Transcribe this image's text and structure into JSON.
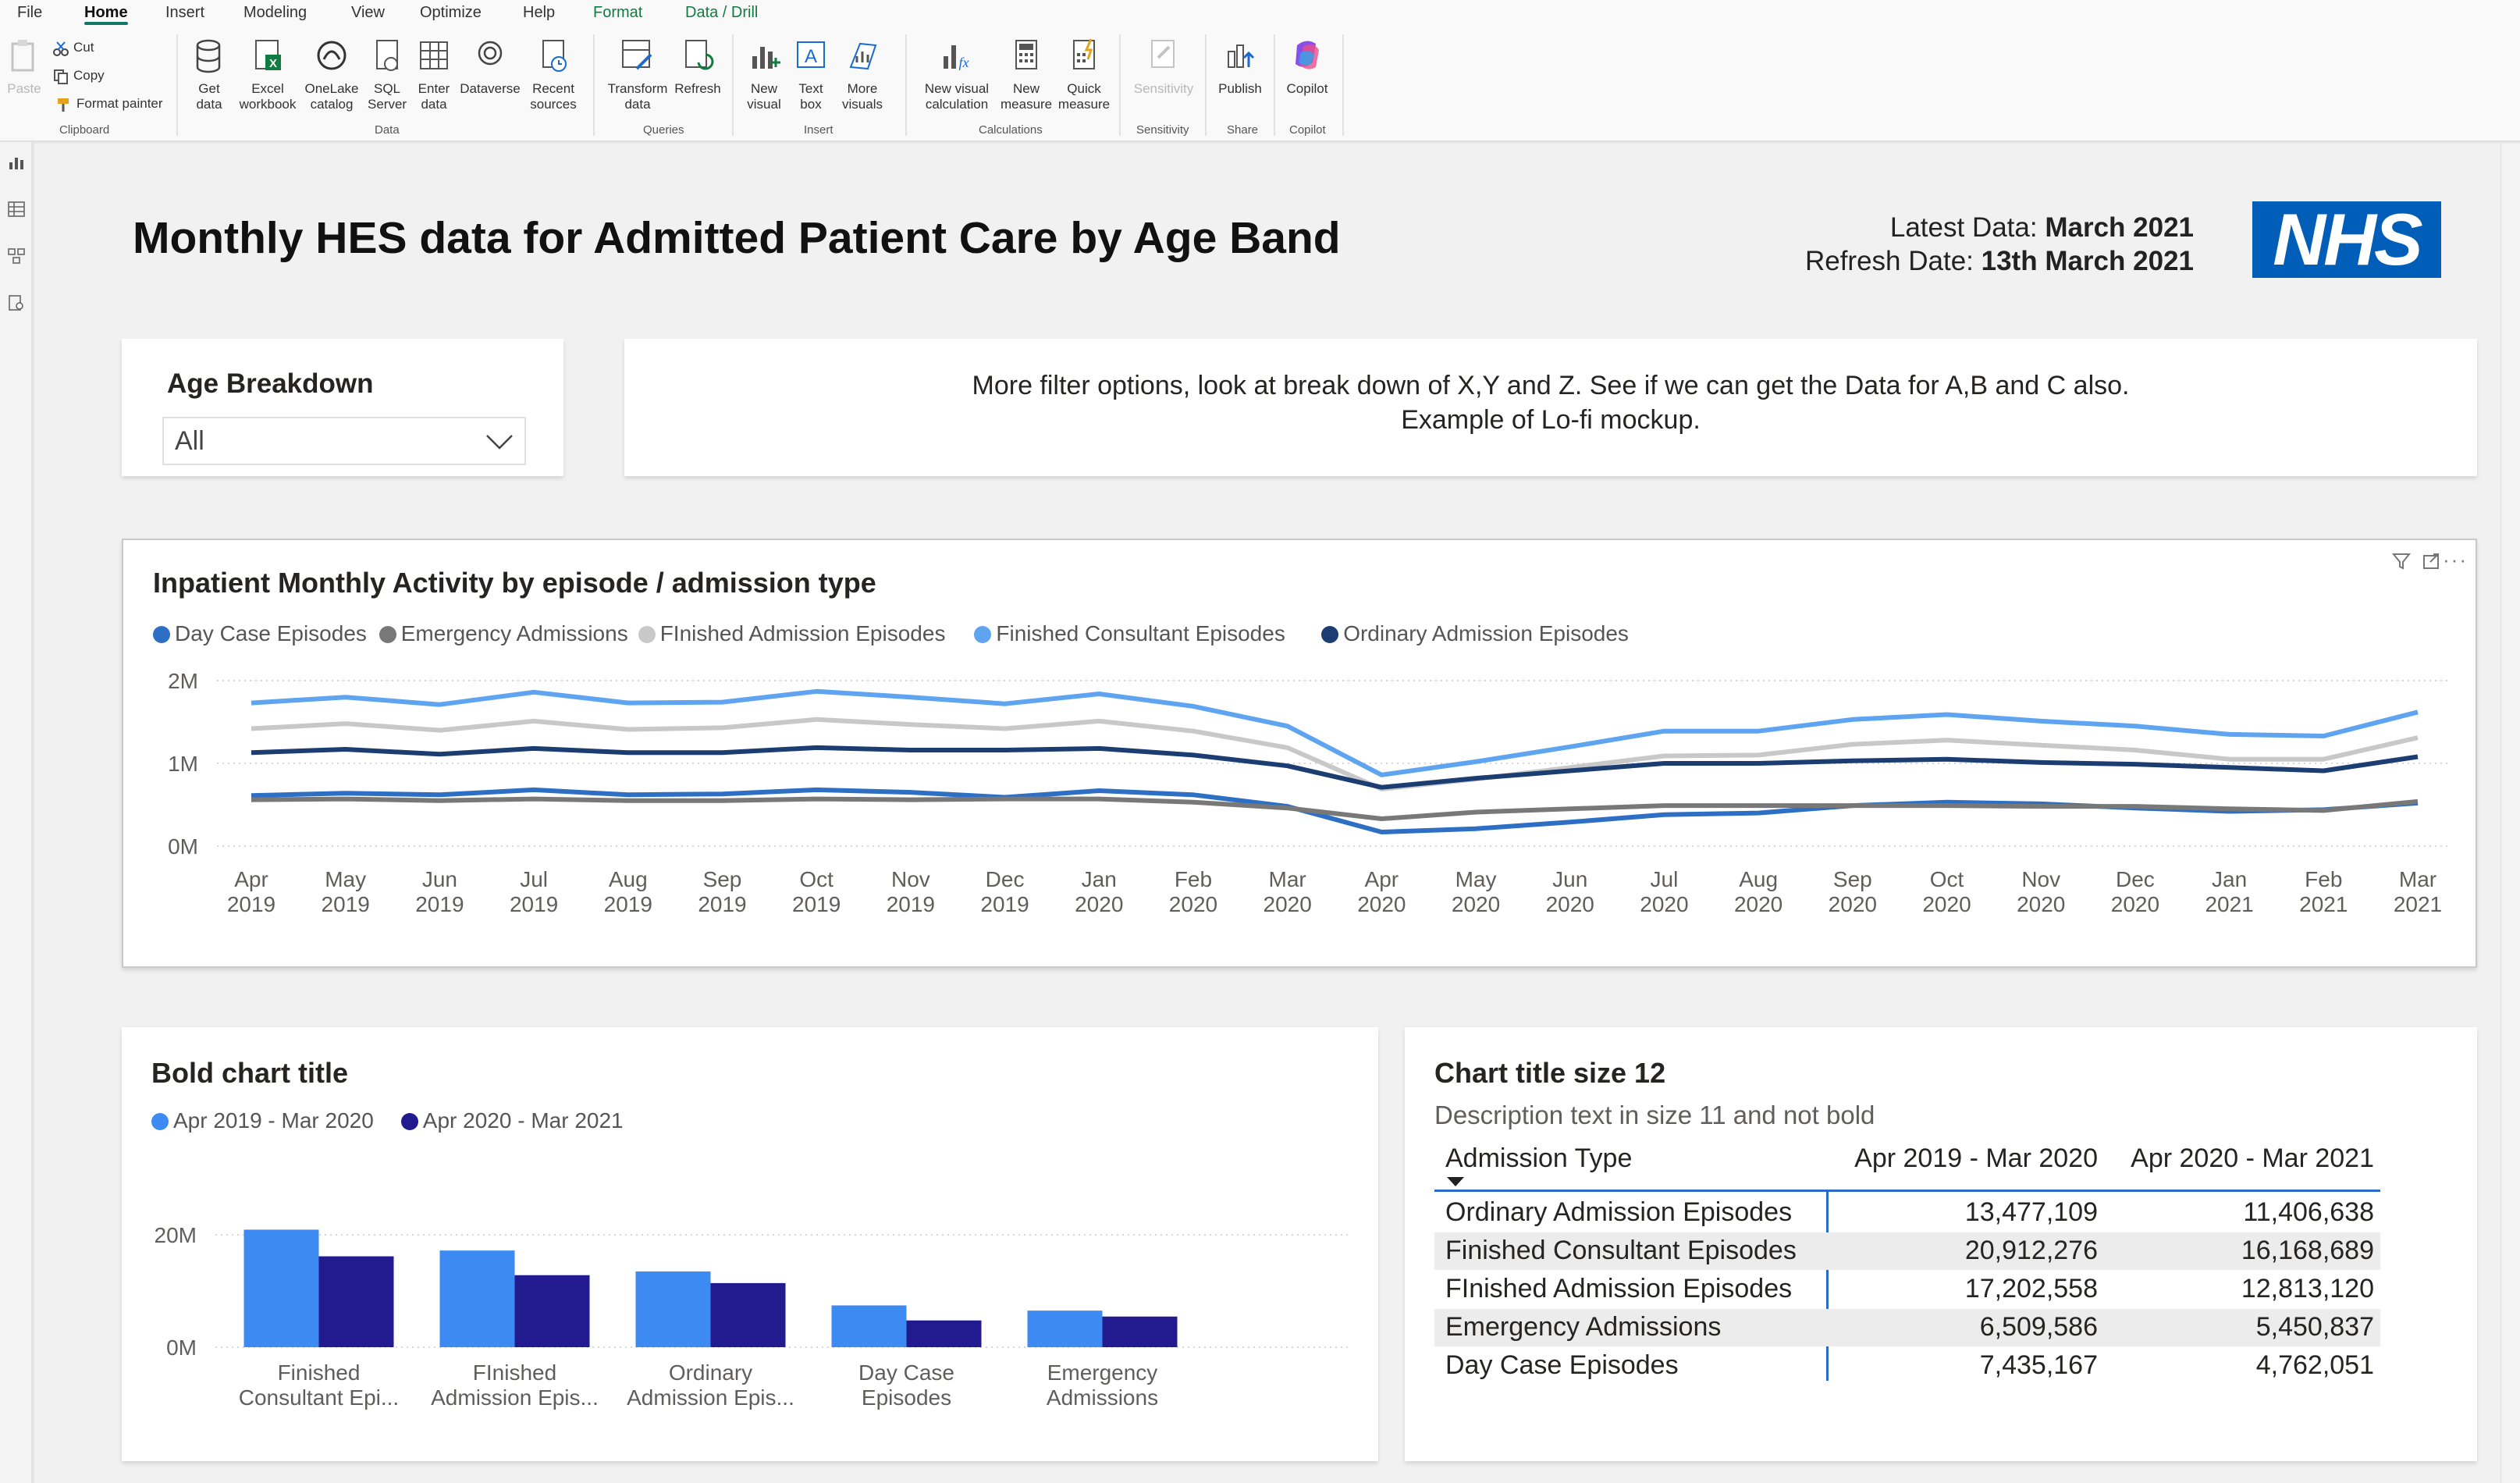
{
  "ribbon": {
    "tabs": [
      "File",
      "Home",
      "Insert",
      "Modeling",
      "View",
      "Optimize",
      "Help",
      "Format",
      "Data / Drill"
    ],
    "clipboard": {
      "paste": "Paste",
      "cut": "Cut",
      "copy": "Copy",
      "format_painter": "Format painter",
      "label": "Clipboard"
    },
    "data_group": {
      "get_data": "Get data",
      "excel": "Excel workbook",
      "onelake": "OneLake catalog",
      "sql": "SQL Server",
      "enter": "Enter data",
      "dataverse": "Dataverse",
      "recent": "Recent sources",
      "label": "Data"
    },
    "queries_group": {
      "transform": "Transform data",
      "refresh": "Refresh",
      "label": "Queries"
    },
    "insert_group": {
      "new_visual": "New visual",
      "text_box": "Text box",
      "more_visuals": "More visuals",
      "label": "Insert"
    },
    "calc_group": {
      "new_visual_calc": "New visual calculation",
      "new_measure": "New measure",
      "quick_measure": "Quick measure",
      "label": "Calculations"
    },
    "sensitivity_group": {
      "sensitivity": "Sensitivity",
      "label": "Sensitivity"
    },
    "share_group": {
      "publish": "Publish",
      "label": "Share"
    },
    "copilot_group": {
      "copilot": "Copilot",
      "label": "Copilot"
    }
  },
  "header": {
    "title": "Monthly HES data for Admitted Patient Care by Age Band",
    "latest_label": "Latest Data: ",
    "latest_value": "March 2021",
    "refresh_label": "Refresh Date: ",
    "refresh_value": "13th March 2021",
    "logo": "NHS"
  },
  "filter": {
    "title": "Age Breakdown",
    "selected": "All"
  },
  "notes": {
    "line1": "More filter options, look at break down of X,Y and Z. See if we can get the Data for A,B and C also.",
    "line2": "Example of Lo-fi mockup."
  },
  "colors": {
    "day_case": "#2e6fc6",
    "emergency": "#787878",
    "finished_admission": "#c8c8c8",
    "finished_consultant": "#5ea4f0",
    "ordinary": "#1b3d72",
    "bar_a": "#3d8bf2",
    "bar_b": "#221b8f",
    "table_border": "#2b6ac7"
  },
  "chart_data": [
    {
      "type": "line",
      "title": "Inpatient Monthly Activity by episode / admission type",
      "x": [
        "Apr 2019",
        "May 2019",
        "Jun 2019",
        "Jul 2019",
        "Aug 2019",
        "Sep 2019",
        "Oct 2019",
        "Nov 2019",
        "Dec 2019",
        "Jan 2020",
        "Feb 2020",
        "Mar 2020",
        "Apr 2020",
        "May 2020",
        "Jun 2020",
        "Jul 2020",
        "Aug 2020",
        "Sep 2020",
        "Oct 2020",
        "Nov 2020",
        "Dec 2020",
        "Jan 2021",
        "Feb 2021",
        "Mar 2021"
      ],
      "x_month": [
        "Apr",
        "May",
        "Jun",
        "Jul",
        "Aug",
        "Sep",
        "Oct",
        "Nov",
        "Dec",
        "Jan",
        "Feb",
        "Mar",
        "Apr",
        "May",
        "Jun",
        "Jul",
        "Aug",
        "Sep",
        "Oct",
        "Nov",
        "Dec",
        "Jan",
        "Feb",
        "Mar"
      ],
      "x_year": [
        "2019",
        "2019",
        "2019",
        "2019",
        "2019",
        "2019",
        "2019",
        "2019",
        "2019",
        "2020",
        "2020",
        "2020",
        "2020",
        "2020",
        "2020",
        "2020",
        "2020",
        "2020",
        "2020",
        "2020",
        "2020",
        "2021",
        "2021",
        "2021"
      ],
      "yticks": [
        "2M",
        "1M",
        "0M"
      ],
      "ytick_values": [
        2000000,
        1000000,
        0
      ],
      "ylim": [
        0,
        2000000
      ],
      "grid": true,
      "legend": "top-left",
      "series": [
        {
          "name": "Day Case Episodes",
          "color_key": "day_case",
          "values": [
            610000,
            640000,
            620000,
            680000,
            620000,
            630000,
            680000,
            650000,
            590000,
            670000,
            620000,
            480000,
            170000,
            210000,
            290000,
            380000,
            400000,
            490000,
            530000,
            510000,
            460000,
            420000,
            440000,
            520000
          ]
        },
        {
          "name": "Emergency Admissions",
          "color_key": "emergency",
          "values": [
            560000,
            570000,
            550000,
            570000,
            550000,
            550000,
            570000,
            560000,
            570000,
            570000,
            530000,
            460000,
            330000,
            410000,
            450000,
            490000,
            490000,
            490000,
            490000,
            480000,
            480000,
            450000,
            430000,
            540000
          ]
        },
        {
          "name": "FInished Admission Episodes",
          "color_key": "finished_admission",
          "values": [
            1420000,
            1480000,
            1400000,
            1510000,
            1410000,
            1430000,
            1530000,
            1470000,
            1420000,
            1510000,
            1390000,
            1190000,
            690000,
            810000,
            950000,
            1090000,
            1100000,
            1230000,
            1280000,
            1220000,
            1160000,
            1050000,
            1050000,
            1310000
          ]
        },
        {
          "name": "Finished Consultant Episodes",
          "color_key": "finished_consultant",
          "values": [
            1730000,
            1800000,
            1710000,
            1860000,
            1730000,
            1740000,
            1870000,
            1800000,
            1720000,
            1840000,
            1690000,
            1450000,
            860000,
            1020000,
            1200000,
            1390000,
            1390000,
            1530000,
            1590000,
            1510000,
            1450000,
            1350000,
            1330000,
            1620000
          ]
        },
        {
          "name": "Ordinary Admission Episodes",
          "color_key": "ordinary",
          "values": [
            1130000,
            1170000,
            1110000,
            1180000,
            1130000,
            1130000,
            1190000,
            1160000,
            1160000,
            1180000,
            1100000,
            970000,
            710000,
            820000,
            910000,
            1000000,
            1000000,
            1030000,
            1050000,
            1010000,
            990000,
            950000,
            910000,
            1080000
          ]
        }
      ]
    },
    {
      "type": "bar",
      "title": "Bold chart title",
      "categories": [
        "Finished Consultant Epi...",
        "FInished Admission Epis...",
        "Ordinary Admission Epis...",
        "Day Case Episodes",
        "Emergency Admissions"
      ],
      "category_lines": [
        [
          "Finished",
          "Consultant Epi..."
        ],
        [
          "FInished",
          "Admission Epis..."
        ],
        [
          "Ordinary",
          "Admission Epis..."
        ],
        [
          "Day Case",
          "Episodes"
        ],
        [
          "Emergency",
          "Admissions"
        ]
      ],
      "yticks": [
        "20M",
        "0M"
      ],
      "ytick_values": [
        20000000,
        0
      ],
      "ylim": [
        0,
        20000000
      ],
      "legend": "top-left",
      "series": [
        {
          "name": "Apr 2019 - Mar 2020",
          "color_key": "bar_a",
          "values": [
            20912276,
            17202558,
            13477109,
            7435167,
            6509586
          ]
        },
        {
          "name": "Apr 2020 - Mar 2021",
          "color_key": "bar_b",
          "values": [
            16168689,
            12813120,
            11406638,
            4762051,
            5450837
          ]
        }
      ]
    },
    {
      "type": "table",
      "title": "Chart title size 12",
      "subtitle": "Description text in size 11 and not bold",
      "columns": [
        "Admission Type",
        "Apr 2019 - Mar 2020",
        "Apr 2020 - Mar 2021"
      ],
      "rows": [
        [
          "Ordinary Admission Episodes",
          "13,477,109",
          "11,406,638"
        ],
        [
          "Finished Consultant Episodes",
          "20,912,276",
          "16,168,689"
        ],
        [
          "FInished Admission Episodes",
          "17,202,558",
          "12,813,120"
        ],
        [
          "Emergency Admissions",
          "6,509,586",
          "5,450,837"
        ],
        [
          "Day Case Episodes",
          "7,435,167",
          "4,762,051"
        ]
      ]
    }
  ]
}
